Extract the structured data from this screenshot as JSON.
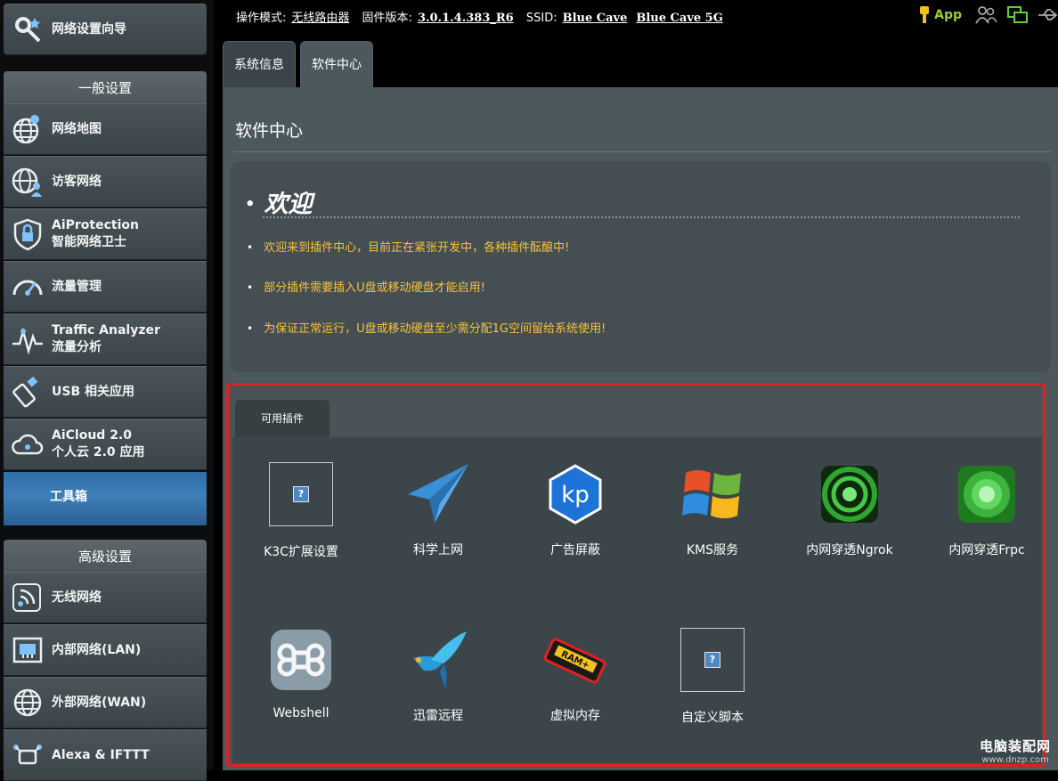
{
  "sidebar": {
    "wizard_label": "网络设置向导",
    "general_heading": "一般设置",
    "general_items": [
      {
        "line1": "网络地图",
        "line2": ""
      },
      {
        "line1": "访客网络",
        "line2": ""
      },
      {
        "line1": "AiProtection",
        "line2": "智能网络卫士"
      },
      {
        "line1": "流量管理",
        "line2": ""
      },
      {
        "line1": "Traffic Analyzer",
        "line2": "流量分析"
      },
      {
        "line1": "USB 相关应用",
        "line2": ""
      },
      {
        "line1": "AiCloud 2.0",
        "line2": "个人云 2.0 应用"
      }
    ],
    "active_item": "工具箱",
    "advanced_heading": "高级设置",
    "advanced_items": [
      {
        "line1": "无线网络"
      },
      {
        "line1": "内部网络(LAN)"
      },
      {
        "line1": "外部网络(WAN)"
      },
      {
        "line1": "Alexa & IFTTT"
      }
    ]
  },
  "topbar": {
    "mode_label": "操作模式:",
    "mode_value": "无线路由器",
    "firmware_label": "固件版本:",
    "firmware_value": "3.0.1.4.383_R6",
    "ssid_label": "SSID:",
    "ssid_1": "Blue Cave",
    "ssid_2": "Blue Cave 5G",
    "app_label": "App"
  },
  "tabs": [
    {
      "label": "系统信息",
      "active": false
    },
    {
      "label": "软件中心",
      "active": true
    }
  ],
  "main": {
    "title": "软件中心",
    "welcome_heading": "欢迎",
    "notices": [
      "欢迎来到插件中心，目前正在紧张开发中，各种插件酝酿中!",
      "部分插件需要插入U盘或移动硬盘才能启用!",
      "为保证正常运行，U盘或移动硬盘至少需分配1G空间留给系统使用!"
    ],
    "panel_tab": "可用插件",
    "plugins": [
      {
        "label": "K3C扩展设置",
        "icon": "placeholder-icon"
      },
      {
        "label": "科学上网",
        "icon": "paper-plane-icon"
      },
      {
        "label": "广告屏蔽",
        "icon": "koolproxy-icon"
      },
      {
        "label": "KMS服务",
        "icon": "windows-icon"
      },
      {
        "label": "内网穿透Ngrok",
        "icon": "tunnel-icon"
      },
      {
        "label": "内网穿透Frpc",
        "icon": "tunnel-green-icon"
      },
      {
        "label": "Webshell",
        "icon": "command-icon"
      },
      {
        "label": "迅雷远程",
        "icon": "xunlei-bird-icon"
      },
      {
        "label": "虚拟内存",
        "icon": "ram-chip-icon"
      },
      {
        "label": "自定义脚本",
        "icon": "placeholder-icon"
      }
    ]
  },
  "watermark": {
    "line1": "电脑装配网",
    "line2": "www.dnzp.com"
  },
  "colors": {
    "accent_blue": "#3f7fb8",
    "notice_yellow": "#f8c13b",
    "highlight_red": "#e02020",
    "app_green": "#9acd32"
  }
}
